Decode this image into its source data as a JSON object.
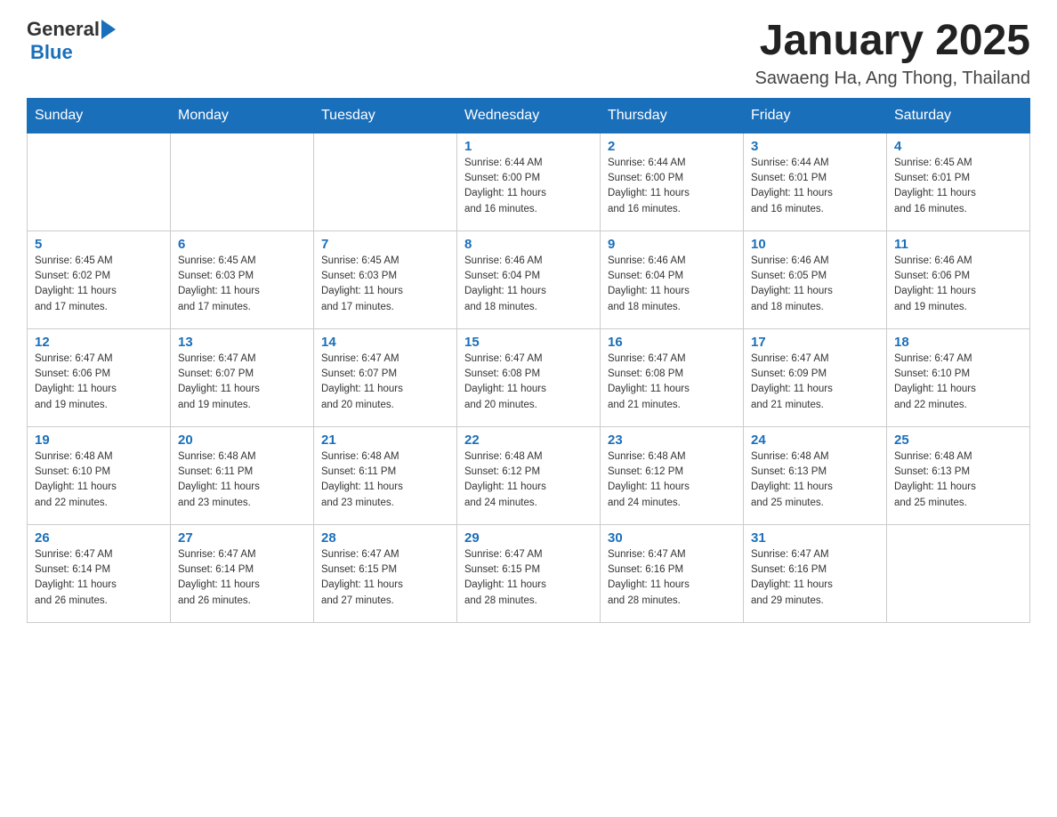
{
  "header": {
    "logo_general": "General",
    "logo_blue": "Blue",
    "title": "January 2025",
    "location": "Sawaeng Ha, Ang Thong, Thailand"
  },
  "days_of_week": [
    "Sunday",
    "Monday",
    "Tuesday",
    "Wednesday",
    "Thursday",
    "Friday",
    "Saturday"
  ],
  "weeks": [
    [
      {
        "day": "",
        "info": ""
      },
      {
        "day": "",
        "info": ""
      },
      {
        "day": "",
        "info": ""
      },
      {
        "day": "1",
        "info": "Sunrise: 6:44 AM\nSunset: 6:00 PM\nDaylight: 11 hours\nand 16 minutes."
      },
      {
        "day": "2",
        "info": "Sunrise: 6:44 AM\nSunset: 6:00 PM\nDaylight: 11 hours\nand 16 minutes."
      },
      {
        "day": "3",
        "info": "Sunrise: 6:44 AM\nSunset: 6:01 PM\nDaylight: 11 hours\nand 16 minutes."
      },
      {
        "day": "4",
        "info": "Sunrise: 6:45 AM\nSunset: 6:01 PM\nDaylight: 11 hours\nand 16 minutes."
      }
    ],
    [
      {
        "day": "5",
        "info": "Sunrise: 6:45 AM\nSunset: 6:02 PM\nDaylight: 11 hours\nand 17 minutes."
      },
      {
        "day": "6",
        "info": "Sunrise: 6:45 AM\nSunset: 6:03 PM\nDaylight: 11 hours\nand 17 minutes."
      },
      {
        "day": "7",
        "info": "Sunrise: 6:45 AM\nSunset: 6:03 PM\nDaylight: 11 hours\nand 17 minutes."
      },
      {
        "day": "8",
        "info": "Sunrise: 6:46 AM\nSunset: 6:04 PM\nDaylight: 11 hours\nand 18 minutes."
      },
      {
        "day": "9",
        "info": "Sunrise: 6:46 AM\nSunset: 6:04 PM\nDaylight: 11 hours\nand 18 minutes."
      },
      {
        "day": "10",
        "info": "Sunrise: 6:46 AM\nSunset: 6:05 PM\nDaylight: 11 hours\nand 18 minutes."
      },
      {
        "day": "11",
        "info": "Sunrise: 6:46 AM\nSunset: 6:06 PM\nDaylight: 11 hours\nand 19 minutes."
      }
    ],
    [
      {
        "day": "12",
        "info": "Sunrise: 6:47 AM\nSunset: 6:06 PM\nDaylight: 11 hours\nand 19 minutes."
      },
      {
        "day": "13",
        "info": "Sunrise: 6:47 AM\nSunset: 6:07 PM\nDaylight: 11 hours\nand 19 minutes."
      },
      {
        "day": "14",
        "info": "Sunrise: 6:47 AM\nSunset: 6:07 PM\nDaylight: 11 hours\nand 20 minutes."
      },
      {
        "day": "15",
        "info": "Sunrise: 6:47 AM\nSunset: 6:08 PM\nDaylight: 11 hours\nand 20 minutes."
      },
      {
        "day": "16",
        "info": "Sunrise: 6:47 AM\nSunset: 6:08 PM\nDaylight: 11 hours\nand 21 minutes."
      },
      {
        "day": "17",
        "info": "Sunrise: 6:47 AM\nSunset: 6:09 PM\nDaylight: 11 hours\nand 21 minutes."
      },
      {
        "day": "18",
        "info": "Sunrise: 6:47 AM\nSunset: 6:10 PM\nDaylight: 11 hours\nand 22 minutes."
      }
    ],
    [
      {
        "day": "19",
        "info": "Sunrise: 6:48 AM\nSunset: 6:10 PM\nDaylight: 11 hours\nand 22 minutes."
      },
      {
        "day": "20",
        "info": "Sunrise: 6:48 AM\nSunset: 6:11 PM\nDaylight: 11 hours\nand 23 minutes."
      },
      {
        "day": "21",
        "info": "Sunrise: 6:48 AM\nSunset: 6:11 PM\nDaylight: 11 hours\nand 23 minutes."
      },
      {
        "day": "22",
        "info": "Sunrise: 6:48 AM\nSunset: 6:12 PM\nDaylight: 11 hours\nand 24 minutes."
      },
      {
        "day": "23",
        "info": "Sunrise: 6:48 AM\nSunset: 6:12 PM\nDaylight: 11 hours\nand 24 minutes."
      },
      {
        "day": "24",
        "info": "Sunrise: 6:48 AM\nSunset: 6:13 PM\nDaylight: 11 hours\nand 25 minutes."
      },
      {
        "day": "25",
        "info": "Sunrise: 6:48 AM\nSunset: 6:13 PM\nDaylight: 11 hours\nand 25 minutes."
      }
    ],
    [
      {
        "day": "26",
        "info": "Sunrise: 6:47 AM\nSunset: 6:14 PM\nDaylight: 11 hours\nand 26 minutes."
      },
      {
        "day": "27",
        "info": "Sunrise: 6:47 AM\nSunset: 6:14 PM\nDaylight: 11 hours\nand 26 minutes."
      },
      {
        "day": "28",
        "info": "Sunrise: 6:47 AM\nSunset: 6:15 PM\nDaylight: 11 hours\nand 27 minutes."
      },
      {
        "day": "29",
        "info": "Sunrise: 6:47 AM\nSunset: 6:15 PM\nDaylight: 11 hours\nand 28 minutes."
      },
      {
        "day": "30",
        "info": "Sunrise: 6:47 AM\nSunset: 6:16 PM\nDaylight: 11 hours\nand 28 minutes."
      },
      {
        "day": "31",
        "info": "Sunrise: 6:47 AM\nSunset: 6:16 PM\nDaylight: 11 hours\nand 29 minutes."
      },
      {
        "day": "",
        "info": ""
      }
    ]
  ]
}
